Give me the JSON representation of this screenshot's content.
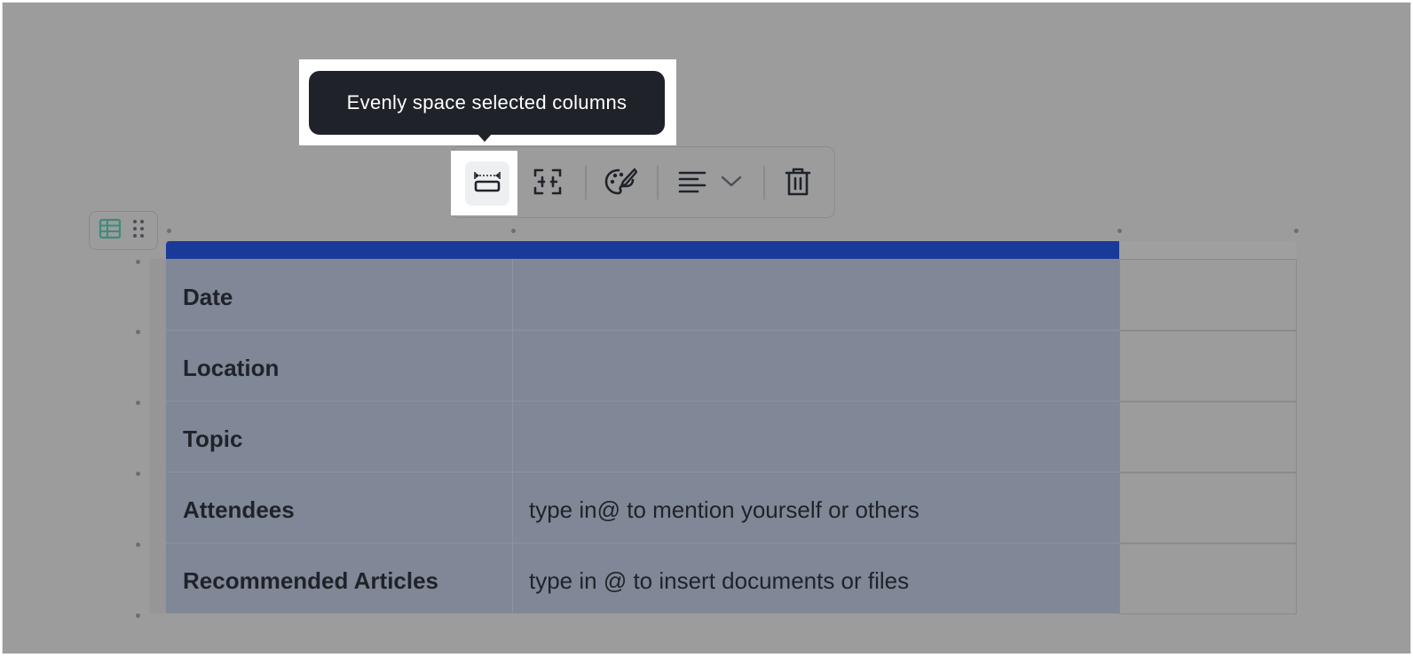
{
  "tooltip": {
    "text": "Evenly space selected columns"
  },
  "toolbar": {
    "buttons": [
      {
        "name": "evenly-space-columns",
        "icon": "distribute-columns-icon",
        "active": true
      },
      {
        "name": "merge-cells",
        "icon": "merge-cells-icon",
        "active": false
      },
      {
        "name": "cell-color",
        "icon": "palette-icon",
        "active": false
      },
      {
        "name": "text-align",
        "icon": "align-left-icon",
        "active": false,
        "has_dropdown": true
      },
      {
        "name": "delete",
        "icon": "trash-icon",
        "active": false
      }
    ]
  },
  "table_handle": {
    "icons": [
      "table-icon",
      "drag-handle-icon"
    ],
    "accent": "#3c8c7c"
  },
  "table": {
    "header_color": "#1a3a9a",
    "selection_color": "#808797",
    "rows": [
      {
        "label": "Date",
        "value": ""
      },
      {
        "label": "Location",
        "value": ""
      },
      {
        "label": "Topic",
        "value": ""
      },
      {
        "label": "Attendees",
        "value": "type in@ to mention yourself or others"
      },
      {
        "label": "Recommended Articles",
        "value": "type in @ to insert documents or files"
      }
    ]
  }
}
